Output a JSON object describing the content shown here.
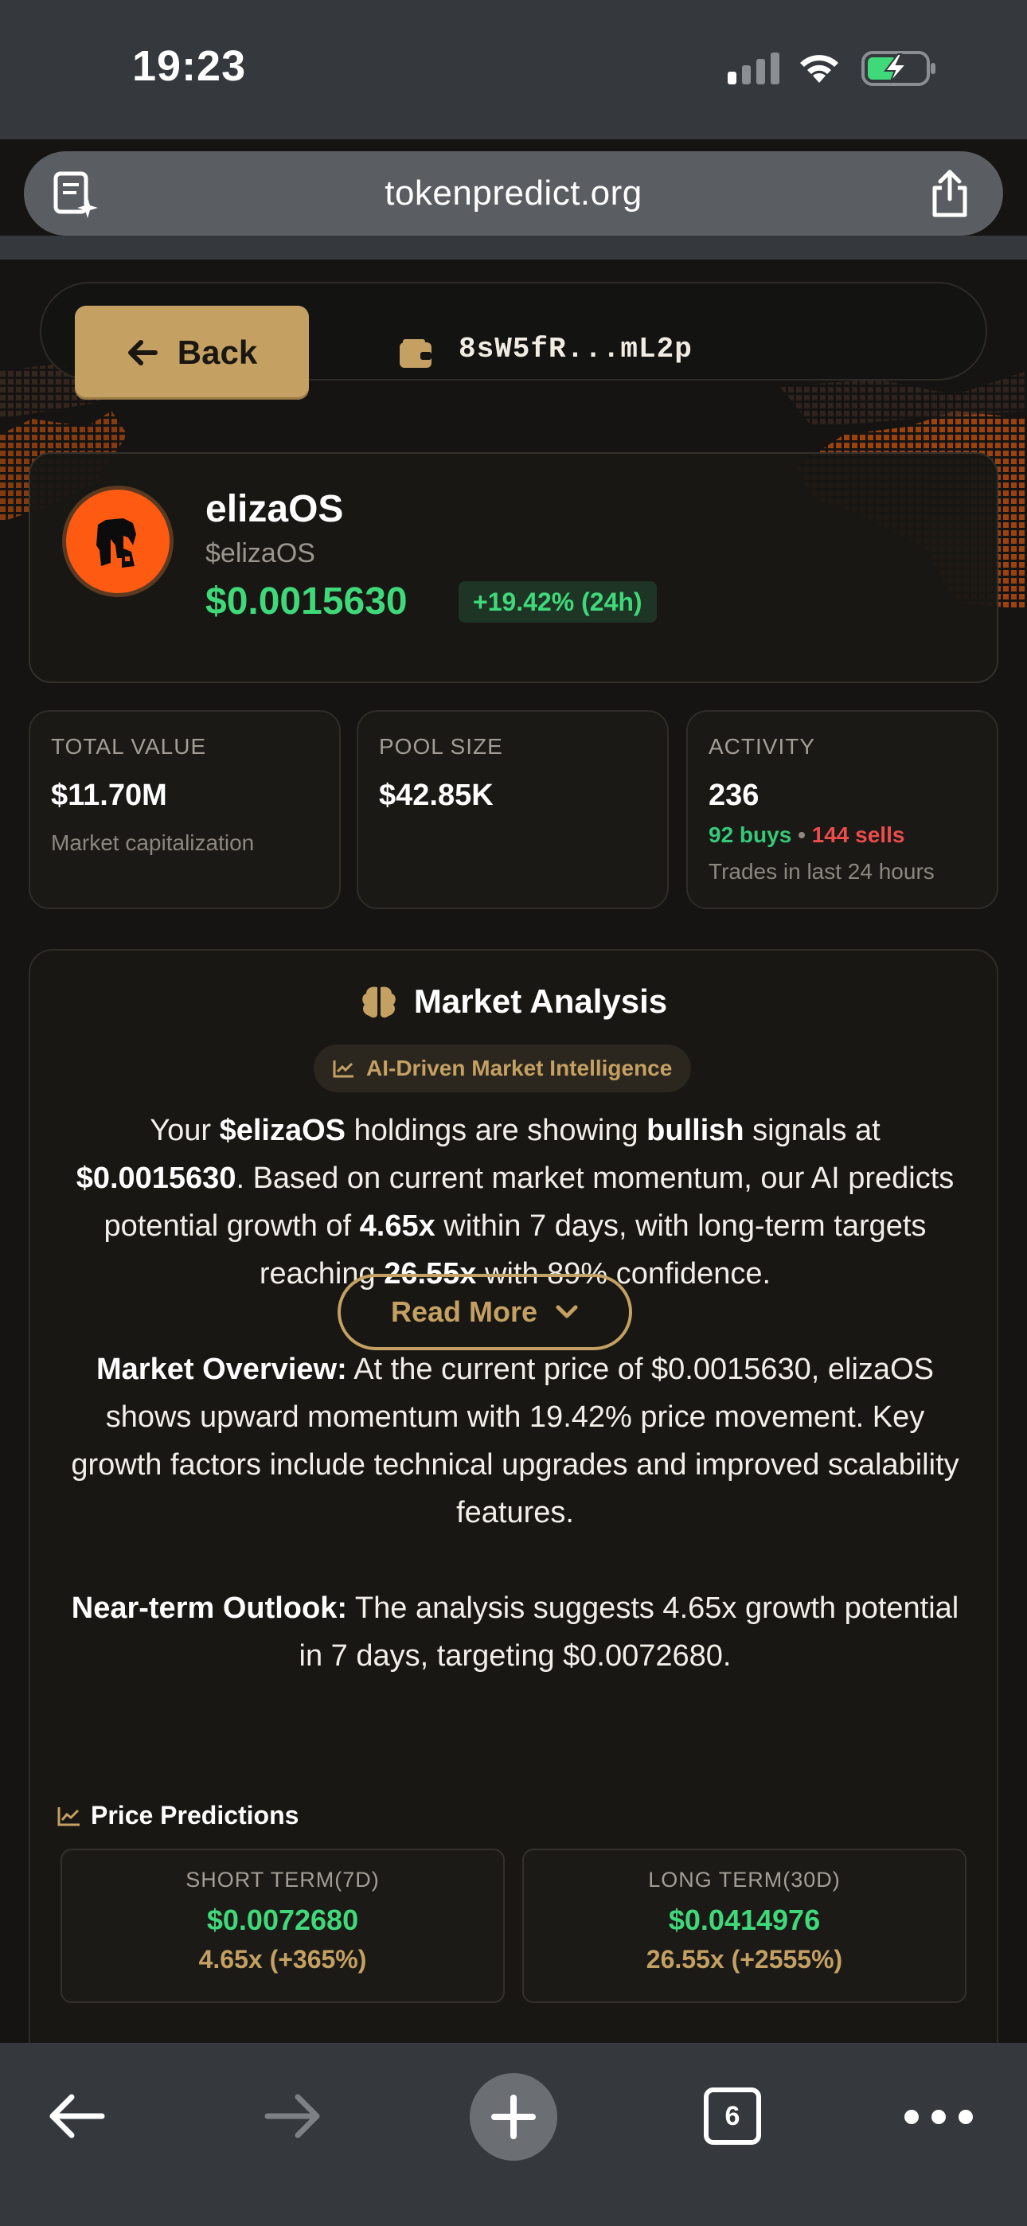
{
  "status_bar": {
    "time": "19:23"
  },
  "browser": {
    "url": "tokenpredict.org",
    "tab_count": "6"
  },
  "wallet_bar": {
    "back_label": "Back",
    "address": "8sW5fR...mL2p"
  },
  "token": {
    "name": "elizaOS",
    "ticker": "$elizaOS",
    "price": "$0.0015630",
    "change": "+19.42% (24h)"
  },
  "stats": {
    "total_value": {
      "label": "TOTAL VALUE",
      "value": "$11.70M",
      "sub": "Market capitalization"
    },
    "pool_size": {
      "label": "POOL SIZE",
      "value": "$42.85K"
    },
    "activity": {
      "label": "ACTIVITY",
      "value": "236",
      "buys": "92 buys",
      "separator": "•",
      "sells": "144 sells",
      "sub": "Trades in last 24 hours"
    }
  },
  "analysis": {
    "title": "Market Analysis",
    "badge": "AI-Driven Market Intelligence",
    "p1": {
      "t1": "Your ",
      "b1": "$elizaOS",
      "t2": " holdings are showing ",
      "b2": "bullish",
      "t3": " signals at ",
      "b3": "$0.0015630",
      "t4": ". Based on current market momentum, our AI predicts potential growth of ",
      "b4": "4.65x",
      "t5": " within 7 days, with long-term targets reaching ",
      "b5": "26.55x",
      "t6": " with 89% confidence."
    },
    "p2": {
      "b1": "Market Overview:",
      "t1": " At the current price of $0.0015630, elizaOS shows upward momentum with 19.42% price movement. Key growth factors include technical upgrades and improved scalability features."
    },
    "p3": {
      "b1": "Near-term Outlook:",
      "t1": " The analysis suggests 4.65x growth potential in 7 days, targeting $0.0072680."
    },
    "read_more": "Read More"
  },
  "predictions": {
    "title": "Price Predictions",
    "short": {
      "label": "SHORT TERM(7D)",
      "price": "$0.0072680",
      "multiplier": "4.65x (+365%)"
    },
    "long": {
      "label": "LONG TERM(30D)",
      "price": "$0.0414976",
      "multiplier": "26.55x (+2555%)"
    }
  },
  "colors": {
    "accent_gold": "#c4a062",
    "positive_green": "#3fd97a",
    "negative_red": "#ee4b4b",
    "background": "#151412",
    "chrome": "#35383c"
  }
}
